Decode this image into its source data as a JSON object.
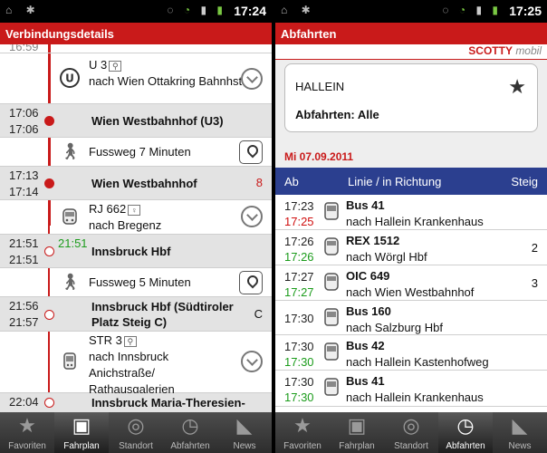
{
  "left": {
    "status_time": "17:24",
    "title": "Verbindungsdetails",
    "top_partial_time": "16:59",
    "legs": [
      {
        "type": "transit",
        "line": "U 3",
        "direction": "nach Wien Ottakring Bahnhst",
        "icon": "u-bahn-icon"
      },
      {
        "type": "stop",
        "arr": "17:06",
        "dep": "17:06",
        "name": "Wien Westbahnhof (U3)",
        "platform": ""
      },
      {
        "type": "walk",
        "text": "Fussweg 7 Minuten"
      },
      {
        "type": "stop",
        "arr": "17:13",
        "dep": "17:14",
        "name": "Wien Westbahnhof",
        "platform": "8"
      },
      {
        "type": "transit",
        "line": "RJ 662",
        "direction": "nach Bregenz",
        "icon": "train-icon"
      },
      {
        "type": "stop",
        "arr": "21:51",
        "realtime": "21:51",
        "dep": "21:51",
        "name": "Innsbruck Hbf",
        "platform": ""
      },
      {
        "type": "walk",
        "text": "Fussweg 5 Minuten"
      },
      {
        "type": "stop",
        "arr": "21:56",
        "dep": "21:57",
        "name": "Innsbruck Hbf (Südtiroler Platz Steig C)",
        "platform": "C"
      },
      {
        "type": "transit",
        "line": "STR 3",
        "direction": "nach Innsbruck Anichstraße/ Rathausgalerien",
        "icon": "tram-icon"
      },
      {
        "type": "stop",
        "arr": "22:04",
        "dep": "",
        "name": "Innsbruck Maria-Theresien-",
        "platform": ""
      }
    ],
    "colors": {
      "accent": "#c91a1a",
      "realtime_green": "#1c9c1c"
    }
  },
  "right": {
    "status_time": "17:25",
    "title": "Abfahrten",
    "brand": "SCOTTY",
    "brand_suffix": "mobil",
    "station": "HALLEIN",
    "filter": "Abfahrten: Alle",
    "date": "Mi 07.09.2011",
    "columns": {
      "col1": "Ab",
      "col2": "Linie / in Richtung",
      "col3": "Steig"
    },
    "departures": [
      {
        "time": "17:23",
        "rt": "17:25",
        "rt_state": "late",
        "line": "Bus 41",
        "direction": "nach Hallein Krankenhaus",
        "platform": ""
      },
      {
        "time": "17:26",
        "rt": "17:26",
        "rt_state": "ontime",
        "line": "REX 1512",
        "direction": "nach Wörgl Hbf",
        "platform": "2"
      },
      {
        "time": "17:27",
        "rt": "17:27",
        "rt_state": "ontime",
        "line": "OIC 649",
        "direction": "nach Wien Westbahnhof",
        "platform": "3"
      },
      {
        "time": "17:30",
        "rt": "",
        "rt_state": "",
        "line": "Bus 160",
        "direction": "nach Salzburg Hbf",
        "platform": ""
      },
      {
        "time": "17:30",
        "rt": "17:30",
        "rt_state": "ontime",
        "line": "Bus 42",
        "direction": "nach Hallein Kastenhofweg",
        "platform": ""
      },
      {
        "time": "17:30",
        "rt": "17:30",
        "rt_state": "ontime",
        "line": "Bus 41",
        "direction": "nach Hallein Krankenhaus",
        "platform": ""
      }
    ]
  },
  "nav": {
    "items": [
      "Favoriten",
      "Fahrplan",
      "Standort",
      "Abfahrten",
      "News"
    ],
    "left_active": "Fahrplan",
    "right_active": "Abfahrten"
  }
}
